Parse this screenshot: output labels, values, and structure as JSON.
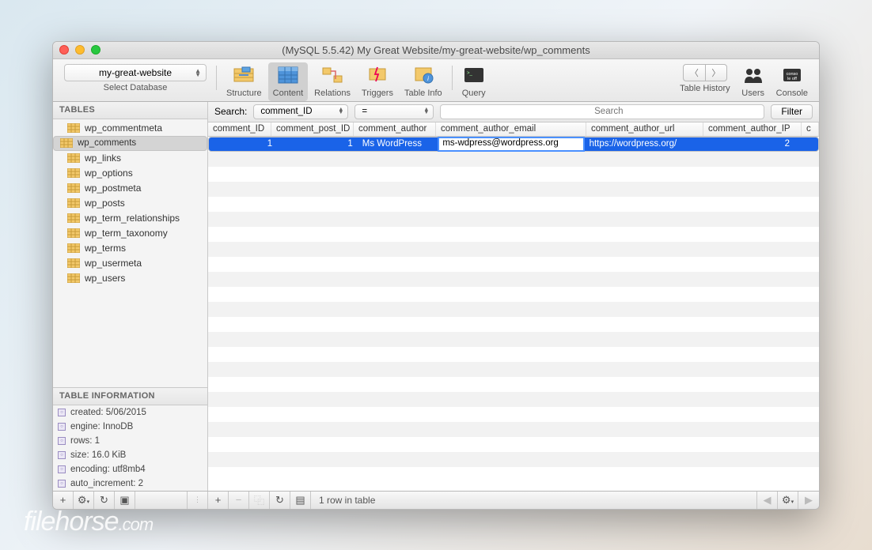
{
  "window": {
    "title": "(MySQL 5.5.42) My Great Website/my-great-website/wp_comments"
  },
  "db_selector": {
    "value": "my-great-website",
    "sub": "Select Database"
  },
  "toolbar": {
    "items": [
      {
        "label": "Structure"
      },
      {
        "label": "Content"
      },
      {
        "label": "Relations"
      },
      {
        "label": "Triggers"
      },
      {
        "label": "Table Info"
      },
      {
        "label": "Query"
      }
    ],
    "history_label": "Table History",
    "users_label": "Users",
    "console_label": "Console"
  },
  "sidebar": {
    "header": "TABLES",
    "tables": [
      "wp_commentmeta",
      "wp_comments",
      "wp_links",
      "wp_options",
      "wp_postmeta",
      "wp_posts",
      "wp_term_relationships",
      "wp_term_taxonomy",
      "wp_terms",
      "wp_usermeta",
      "wp_users"
    ],
    "selected_index": 1,
    "info_header": "TABLE INFORMATION",
    "info": [
      "created: 5/06/2015",
      "engine: InnoDB",
      "rows: 1",
      "size: 16.0 KiB",
      "encoding: utf8mb4",
      "auto_increment: 2"
    ]
  },
  "search": {
    "label": "Search:",
    "column": "comment_ID",
    "op": "=",
    "placeholder": "Search",
    "filter_label": "Filter"
  },
  "columns": [
    "comment_ID",
    "comment_post_ID",
    "comment_author",
    "comment_author_email",
    "comment_author_url",
    "comment_author_IP",
    "c"
  ],
  "row": {
    "comment_ID": "1",
    "comment_post_ID": "1",
    "comment_author": "Ms WordPress",
    "comment_author_email": "ms-wdpress@wordpress.org",
    "comment_author_url": "https://wordpress.org/",
    "comment_author_IP": "2"
  },
  "status": "1 row in table",
  "watermark": {
    "name": "filehorse",
    "tld": ".com"
  }
}
